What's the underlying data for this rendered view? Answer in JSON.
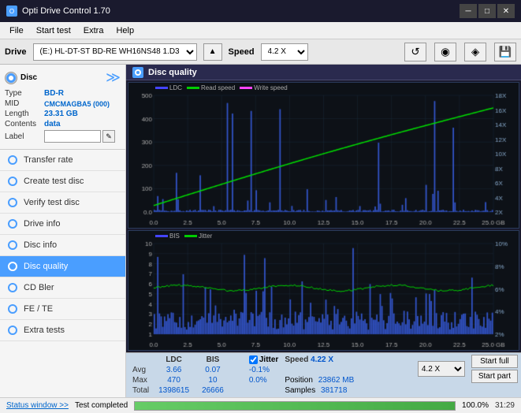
{
  "app": {
    "title": "Opti Drive Control 1.70",
    "icon": "O"
  },
  "titlebar": {
    "minimize": "─",
    "maximize": "□",
    "close": "✕"
  },
  "menubar": {
    "items": [
      "File",
      "Start test",
      "Extra",
      "Help"
    ]
  },
  "drivebar": {
    "label": "Drive",
    "drive_value": "(E:)  HL-DT-ST BD-RE  WH16NS48 1.D3",
    "speed_label": "Speed",
    "speed_value": "4.2 X"
  },
  "disc": {
    "type_label": "Type",
    "type_value": "BD-R",
    "mid_label": "MID",
    "mid_value": "CMCMAGBA5 (000)",
    "length_label": "Length",
    "length_value": "23.31 GB",
    "contents_label": "Contents",
    "contents_value": "data",
    "label_label": "Label",
    "label_value": ""
  },
  "nav": {
    "items": [
      {
        "id": "transfer-rate",
        "label": "Transfer rate",
        "active": false
      },
      {
        "id": "create-test-disc",
        "label": "Create test disc",
        "active": false
      },
      {
        "id": "verify-test-disc",
        "label": "Verify test disc",
        "active": false
      },
      {
        "id": "drive-info",
        "label": "Drive info",
        "active": false
      },
      {
        "id": "disc-info",
        "label": "Disc info",
        "active": false
      },
      {
        "id": "disc-quality",
        "label": "Disc quality",
        "active": true
      },
      {
        "id": "cd-bler",
        "label": "CD Bler",
        "active": false
      },
      {
        "id": "fe-te",
        "label": "FE / TE",
        "active": false
      },
      {
        "id": "extra-tests",
        "label": "Extra tests",
        "active": false
      }
    ]
  },
  "disc_quality": {
    "title": "Disc quality",
    "legend": {
      "ldc": "LDC",
      "read_speed": "Read speed",
      "write_speed": "Write speed",
      "bis": "BIS",
      "jitter": "Jitter"
    }
  },
  "stats": {
    "columns": [
      "LDC",
      "BIS",
      "",
      "Jitter",
      "Speed"
    ],
    "rows": [
      {
        "label": "Avg",
        "ldc": "3.66",
        "bis": "0.07",
        "jitter": "-0.1%",
        "speed": "4.22 X"
      },
      {
        "label": "Max",
        "ldc": "470",
        "bis": "10",
        "jitter": "0.0%",
        "speed_label": "Position",
        "speed_val": "23862 MB"
      },
      {
        "label": "Total",
        "ldc": "1398615",
        "bis": "26666",
        "jitter": "",
        "speed_label2": "Samples",
        "speed_val2": "381718"
      }
    ],
    "jitter_checked": true,
    "jitter_label": "Jitter",
    "speed_label": "Speed",
    "speed_value": "4.22 X",
    "position_label": "Position",
    "position_value": "23862 MB",
    "samples_label": "Samples",
    "samples_value": "381718",
    "speed_select": "4.2 X",
    "start_full": "Start full",
    "start_part": "Start part"
  },
  "statusbar": {
    "status_window": "Status window >>",
    "progress": 100,
    "status_text": "Test completed",
    "time": "31:29"
  },
  "chart_top": {
    "y_left": [
      "500",
      "400",
      "300",
      "200",
      "100",
      "0.0"
    ],
    "y_right": [
      "18X",
      "16X",
      "14X",
      "12X",
      "10X",
      "8X",
      "6X",
      "4X",
      "2X"
    ],
    "x_labels": [
      "0.0",
      "2.5",
      "5.0",
      "7.5",
      "10.0",
      "12.5",
      "15.0",
      "17.5",
      "20.0",
      "22.5",
      "25.0 GB"
    ]
  },
  "chart_bottom": {
    "y_left": [
      "10",
      "9",
      "8",
      "7",
      "6",
      "5",
      "4",
      "3",
      "2",
      "1"
    ],
    "y_right": [
      "10%",
      "8%",
      "6%",
      "4%",
      "2%"
    ],
    "x_labels": [
      "0.0",
      "2.5",
      "5.0",
      "7.5",
      "10.0",
      "12.5",
      "15.0",
      "17.5",
      "20.0",
      "22.5",
      "25.0 GB"
    ]
  }
}
